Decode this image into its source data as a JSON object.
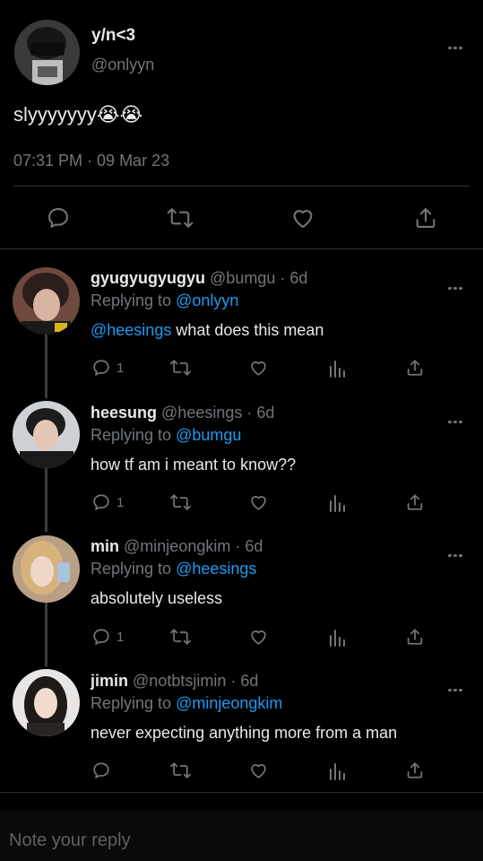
{
  "main_tweet": {
    "display_name": "y/n<3",
    "handle": "@onlyyn",
    "text": "slyyyyyyy😭😭",
    "timestamp": "07:31 PM · 09 Mar 23"
  },
  "replies": [
    {
      "display_name": "gyugyugyugyu",
      "meta": "@bumgu · 6d",
      "replying_prefix": "Replying to ",
      "replying_to": "@onlyyn",
      "mention": "@heesings",
      "text": " what does this mean",
      "reply_count": "1"
    },
    {
      "display_name": "heesung",
      "meta": "@heesings · 6d",
      "replying_prefix": "Replying to ",
      "replying_to": "@bumgu",
      "text": "how tf am i meant to know??",
      "reply_count": "1"
    },
    {
      "display_name": "min",
      "meta": "@minjeongkim · 6d",
      "replying_prefix": "Replying to ",
      "replying_to": "@heesings",
      "text": "absolutely useless",
      "reply_count": "1"
    },
    {
      "display_name": "jimin",
      "meta": "@notbtsjimin · 6d",
      "replying_prefix": "Replying to ",
      "replying_to": "@minjeongkim",
      "text": "never expecting anything more from a man",
      "reply_count": ""
    }
  ],
  "reply_box": {
    "placeholder": "Note your reply"
  },
  "colors": {
    "background": "#000000",
    "text": "#e7e9ea",
    "muted": "#71767b",
    "link": "#1d9bf0",
    "divider": "#2f3336"
  },
  "icons": [
    "more-icon",
    "reply-icon",
    "retweet-icon",
    "like-icon",
    "views-icon",
    "share-icon"
  ]
}
